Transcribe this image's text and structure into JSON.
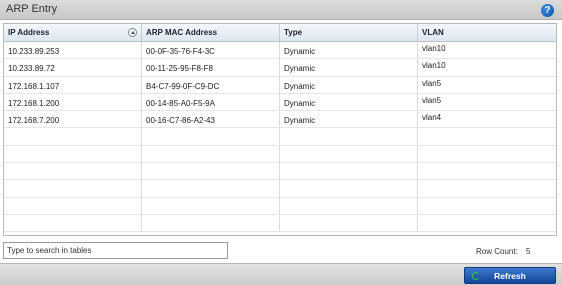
{
  "panel": {
    "title": "ARP Entry",
    "help_label": "?"
  },
  "table": {
    "columns": [
      "IP Address",
      "ARP MAC Address",
      "Type",
      "VLAN"
    ],
    "rows": [
      [
        "10.233.89.253",
        "00-0F-35-76-F4-3C",
        "Dynamic",
        "vlan10"
      ],
      [
        "10.233.89.72",
        "00-11-25-95-F8-F8",
        "Dynamic",
        "vlan10"
      ],
      [
        "172.168.1.107",
        "B4-C7-99-0F-C9-DC",
        "Dynamic",
        "vlan5"
      ],
      [
        "172.168.1.200",
        "00-14-85-A0-F5-9A",
        "Dynamic",
        "vlan5"
      ],
      [
        "172.168.7.200",
        "00-16-C7-86-A2-43",
        "Dynamic",
        "vlan4"
      ]
    ]
  },
  "search": {
    "placeholder": "Type to search in tables"
  },
  "row_count": {
    "label": "Row Count:",
    "value": "5"
  },
  "footer": {
    "refresh_label": "Refresh"
  }
}
